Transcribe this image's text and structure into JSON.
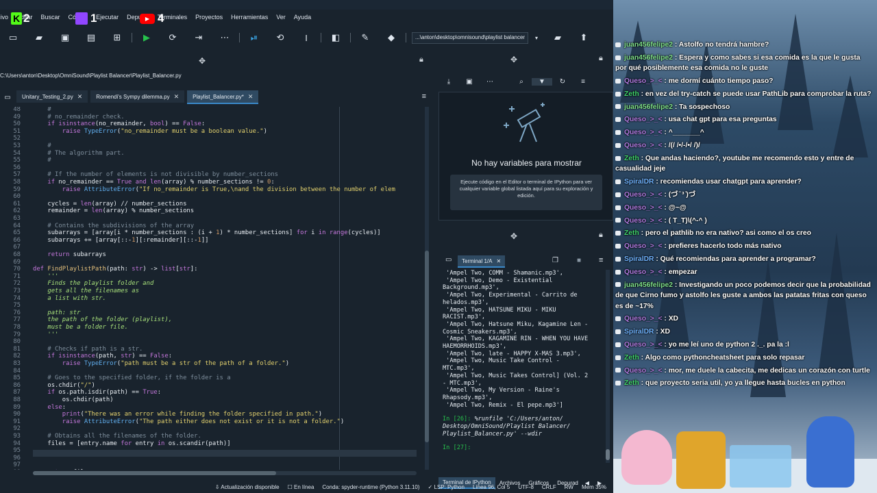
{
  "menu": [
    "Archivo",
    "Editar",
    "Buscar",
    "Código",
    "Ejecutar",
    "Depurar",
    "Terminales",
    "Proyectos",
    "Herramientas",
    "Ver",
    "Ayuda"
  ],
  "overlay": {
    "k_count": "2",
    "twitch_count": "1",
    "youtube_count": "4"
  },
  "toolbar": {
    "path": "...\\anton\\desktop\\omnisound\\playlist balancer"
  },
  "editor": {
    "filepath": "C:\\Users\\anton\\Desktop\\OmniSound\\Playlist Balancer\\Playlist_Balancer.py",
    "tabs": [
      {
        "label": "Unitary_Testing_2.py",
        "active": false
      },
      {
        "label": "Romendi's Sympy dilemma.py",
        "active": false
      },
      {
        "label": "Playlist_Balancer.py*",
        "active": true
      }
    ]
  },
  "variable_explorer": {
    "empty_title": "No hay variables para mostrar",
    "hint": "Ejecute código en el Editor o terminal de IPython para ver cualquier variable global listada aquí para su exploración y edición."
  },
  "console": {
    "tab": "Terminal 1/A",
    "output": [
      " 'Ampel Two, COMM - Shamanic.mp3',",
      " 'Ampel Two, Demo - Existential",
      "Background.mp3',",
      " 'Ampel Two, Experimental - Carrito de",
      "helados.mp3',",
      " 'Ampel Two, HATSUNE MIKU - MIKU",
      "RACIST.mp3',",
      " 'Ampel Two, Hatsune Miku, Kagamine Len -",
      "Cosmic Sneakers.mp3',",
      " 'Ampel Two, KAGAMINE RIN - WHEN YOU HAVE",
      "HAEMORRHOIDS.mp3',",
      " 'Ampel Two, late - HAPPY X-MAS 3.mp3',",
      " 'Ampel Two, Music Take Control -",
      "MTC.mp3',",
      " 'Ampel Two, Music Takes Control] (Vol. 2",
      "- MTC.mp3',",
      " 'Ampel Two, My Version - Raine's",
      "Rhapsody.mp3',",
      " 'Ampel Two, Remix - El pepe.mp3']"
    ],
    "prompt1": "In [26]:",
    "run1": " %runfile 'C:/Users/anton/",
    "run2": "Desktop/OmniSound/Playlist Balancer/",
    "run3": "Playlist_Balancer.py' --wdir",
    "prompt2": "In [27]:",
    "bottom_tabs": [
      "Terminal de IPython",
      "Archivos",
      "Gráficos",
      "Depurad"
    ]
  },
  "status": [
    "Actualización disponible",
    "En línea",
    "Conda: spyder-runtime (Python 3.11.10)",
    "LSP: Python",
    "Línea 96, Col 5",
    "UTF-8",
    "CRLF",
    "RW",
    "Mem 35%"
  ],
  "chat": [
    {
      "user": "juan456felipe2",
      "cls": "u-juan",
      "text": "Astolfo no tendrá hambre?"
    },
    {
      "user": "juan456felipe2",
      "cls": "u-juan",
      "text": "Espera y como sabes si esa comida es la que le gusta por qué posiblemente esa comida no le guste"
    },
    {
      "user": "Queso_>_<",
      "cls": "u-queso",
      "text": "me dormí cuánto tiempo paso?"
    },
    {
      "user": "Zeth",
      "cls": "u-zeth",
      "text": "en vez del try-catch se puede usar PathLib para comprobar la ruta?"
    },
    {
      "user": "juan456felipe2",
      "cls": "u-juan",
      "text": "Ta sospechoso"
    },
    {
      "user": "Queso_>_<",
      "cls": "u-queso",
      "text": "usa chat gpt para esa preguntas"
    },
    {
      "user": "Queso_>_<",
      "cls": "u-queso",
      "text": "^_______^"
    },
    {
      "user": "Queso_>_<",
      "cls": "u-queso",
      "text": "/(/ /•/-/•/ /)/"
    },
    {
      "user": "Zeth",
      "cls": "u-zeth",
      "text": "Que andas haciendo?, youtube me recomendo esto y entre de casualidad jeje"
    },
    {
      "user": "SpiralDR",
      "cls": "u-spiral",
      "text": "recomiendas usar chatgpt para aprender?"
    },
    {
      "user": "Queso_>_<",
      "cls": "u-queso",
      "text": "(づ ̄ ³ ̄)づ"
    },
    {
      "user": "Queso_>_<",
      "cls": "u-queso",
      "text": "@~@"
    },
    {
      "user": "Queso_>_<",
      "cls": "u-queso",
      "text": "( T_T)\\(^-^ )"
    },
    {
      "user": "Zeth",
      "cls": "u-zeth",
      "text": "pero el pathlib no era nativo? asi como el os creo"
    },
    {
      "user": "Queso_>_<",
      "cls": "u-queso",
      "text": "prefieres hacerlo todo más nativo"
    },
    {
      "user": "SpiralDR",
      "cls": "u-spiral",
      "text": "Qué recomiendas para aprender a programar?"
    },
    {
      "user": "Queso_>_<",
      "cls": "u-queso",
      "text": "empezar"
    },
    {
      "user": "juan456felipe2",
      "cls": "u-juan",
      "text": "Investigando un poco podemos decir que la probabilidad de que Cirno fumo y astolfo les guste a ambos las patatas fritas con queso es de ~17%"
    },
    {
      "user": "Queso_>_<",
      "cls": "u-queso",
      "text": "XD"
    },
    {
      "user": "SpiralDR",
      "cls": "u-spiral",
      "text": "XD"
    },
    {
      "user": "Queso_>_<",
      "cls": "u-queso",
      "text": "yo me leí uno de python 2 ._. pa la :l"
    },
    {
      "user": "Zeth",
      "cls": "u-zeth",
      "text": "Algo como pythoncheatsheet para solo repasar"
    },
    {
      "user": "Queso_>_<",
      "cls": "u-queso",
      "text": "mor, me duele la cabecita, me dedicas un corazón con turtle"
    },
    {
      "user": "Zeth",
      "cls": "u-zeth",
      "text": "que proyecto seria util, yo ya llegue hasta bucles en python"
    }
  ]
}
